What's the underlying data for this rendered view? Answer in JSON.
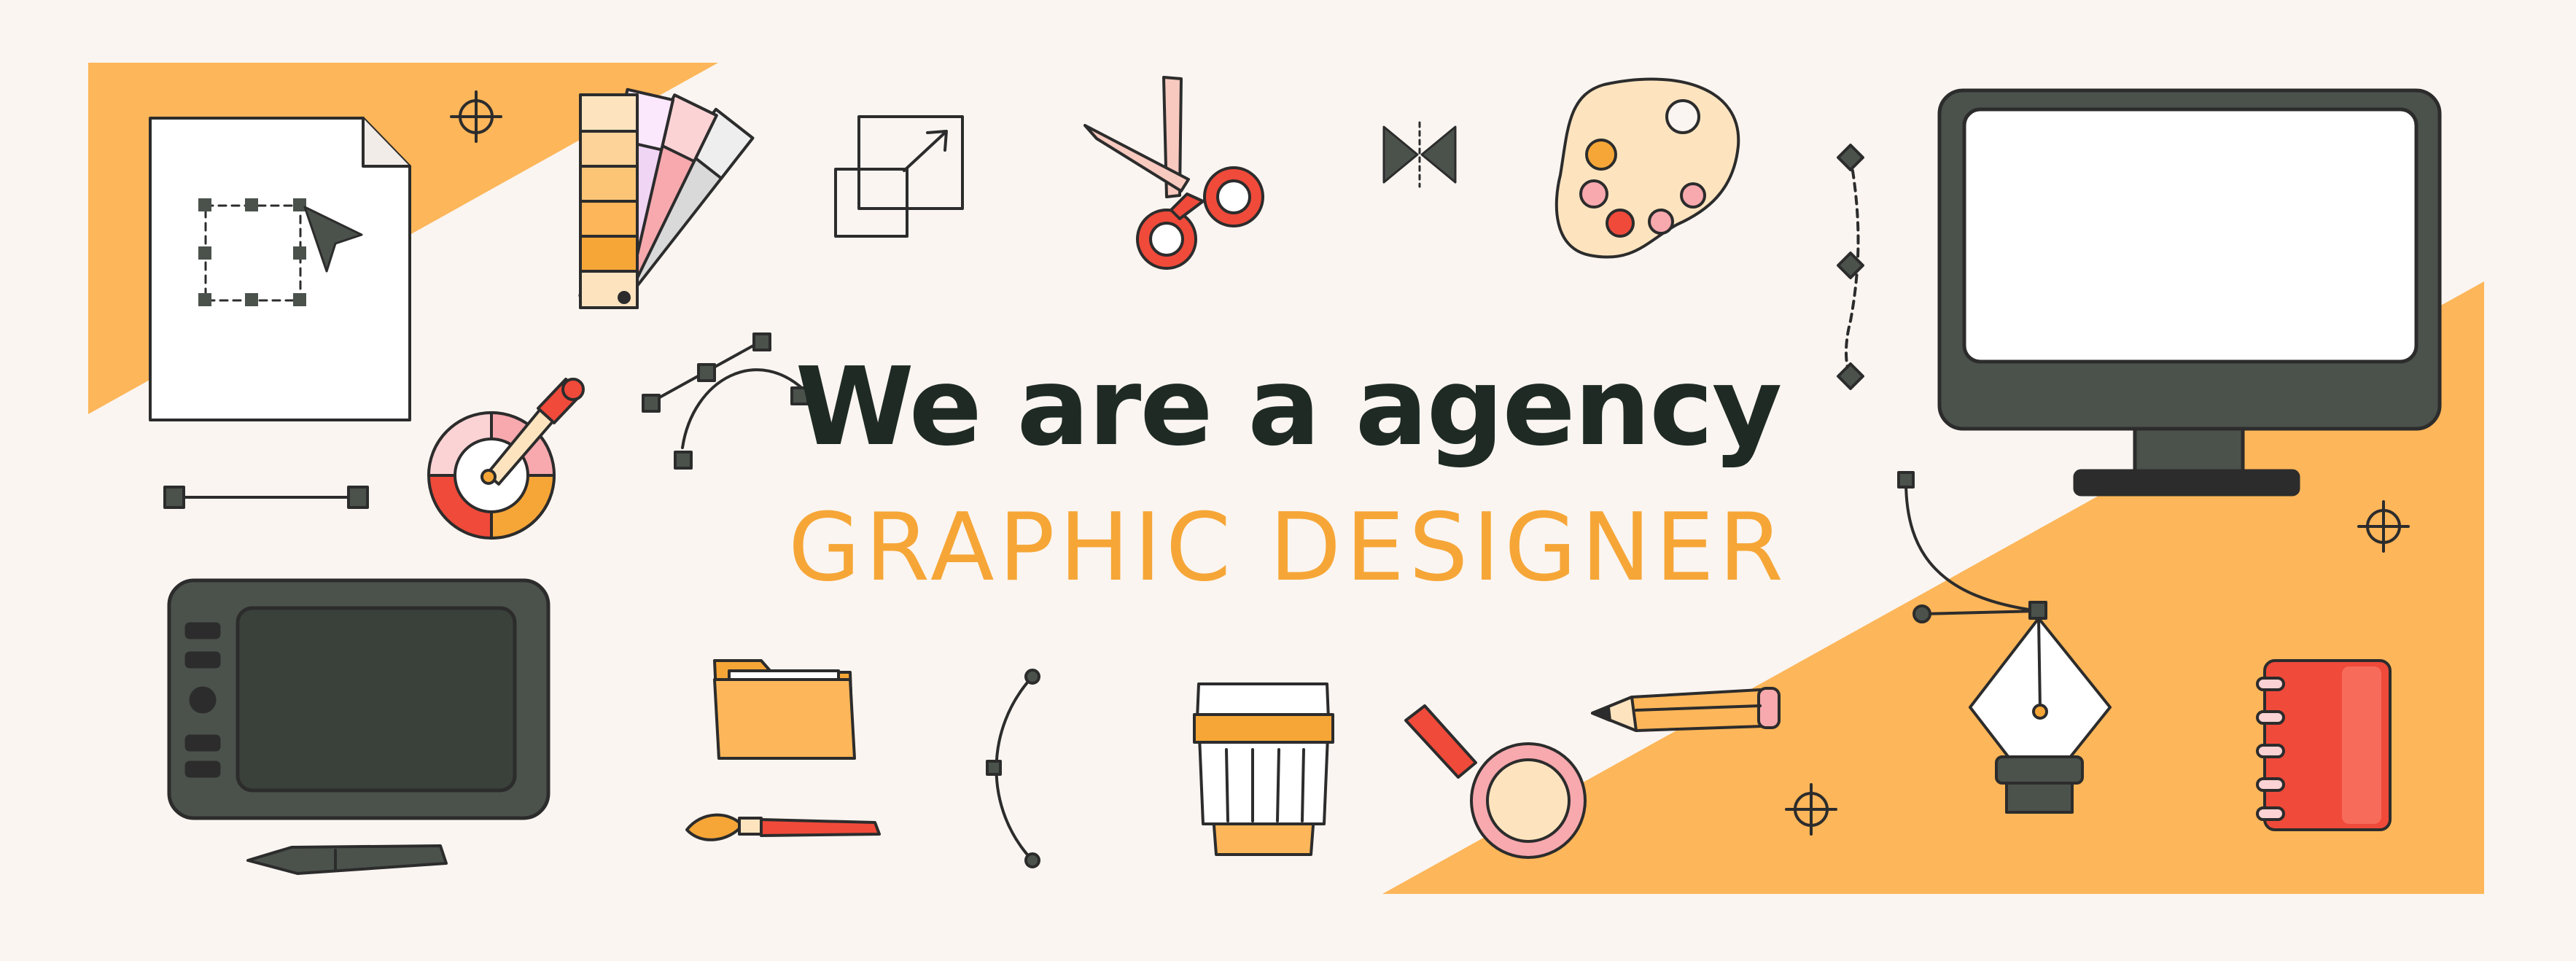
{
  "headline": "We are a agency",
  "subline": "GRAPHIC DESIGNER",
  "colors": {
    "background": "#faf5f1",
    "accent": "#fdb659",
    "accent_text": "#f6a637",
    "dark": "#1f2a25",
    "device_gray": "#4b524c",
    "red": "#f04a3a",
    "pink": "#f7a9ae",
    "outline": "#2c2c2c"
  },
  "icons": [
    "document-selection-icon",
    "crosshair-icon",
    "color-swatch-fan-icon",
    "resize-frames-icon",
    "scissors-icon",
    "bowtie-icon",
    "paint-palette-icon",
    "anchor-path-icon",
    "monitor-icon",
    "color-wheel-icon",
    "eyedropper-icon",
    "bezier-curve-icon",
    "line-segment-icon",
    "drawing-tablet-icon",
    "stylus-icon",
    "folder-icon",
    "paintbrush-icon",
    "arc-curve-icon",
    "coffee-cup-icon",
    "magnifier-icon",
    "pencil-icon",
    "pen-nib-icon",
    "notebook-icon"
  ]
}
